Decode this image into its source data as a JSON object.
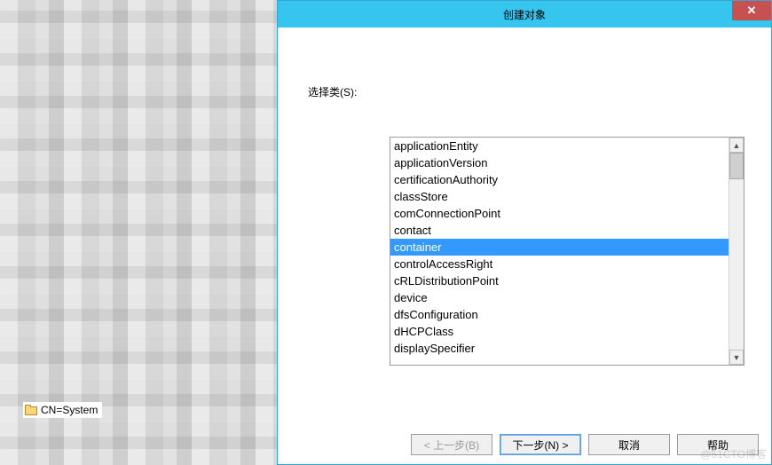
{
  "tree": {
    "visible_node_label": "CN=System"
  },
  "dialog": {
    "title": "创建对象",
    "close_glyph": "✕",
    "label": "选择类(S):",
    "list_items": [
      "applicationEntity",
      "applicationVersion",
      "certificationAuthority",
      "classStore",
      "comConnectionPoint",
      "contact",
      "container",
      "controlAccessRight",
      "cRLDistributionPoint",
      "device",
      "dfsConfiguration",
      "dHCPClass",
      "displaySpecifier"
    ],
    "selected_index": 6,
    "buttons": {
      "back": "< 上一步(B)",
      "next": "下一步(N) >",
      "cancel": "取消",
      "help": "帮助"
    }
  },
  "watermark": "@51CTO博客"
}
